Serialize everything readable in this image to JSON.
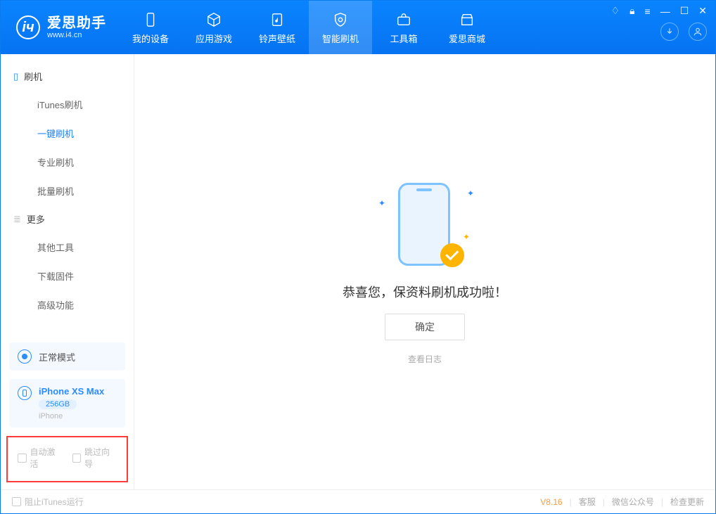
{
  "app": {
    "title": "爱思助手",
    "subtitle": "www.i4.cn"
  },
  "tabs": [
    {
      "label": "我的设备"
    },
    {
      "label": "应用游戏"
    },
    {
      "label": "铃声壁纸"
    },
    {
      "label": "智能刷机"
    },
    {
      "label": "工具箱"
    },
    {
      "label": "爱思商城"
    }
  ],
  "sidebar": {
    "sec1": "刷机",
    "items1": [
      "iTunes刷机",
      "一键刷机",
      "专业刷机",
      "批量刷机"
    ],
    "sec2": "更多",
    "items2": [
      "其他工具",
      "下载固件",
      "高级功能"
    ]
  },
  "mode": {
    "label": "正常模式"
  },
  "device": {
    "name": "iPhone XS Max",
    "storage": "256GB",
    "type": "iPhone"
  },
  "options": {
    "opt1": "自动激活",
    "opt2": "跳过向导"
  },
  "main": {
    "success": "恭喜您，保资料刷机成功啦！",
    "ok": "确定",
    "log": "查看日志"
  },
  "footer": {
    "block_itunes": "阻止iTunes运行",
    "version": "V8.16",
    "support": "客服",
    "wechat": "微信公众号",
    "update": "检查更新"
  }
}
